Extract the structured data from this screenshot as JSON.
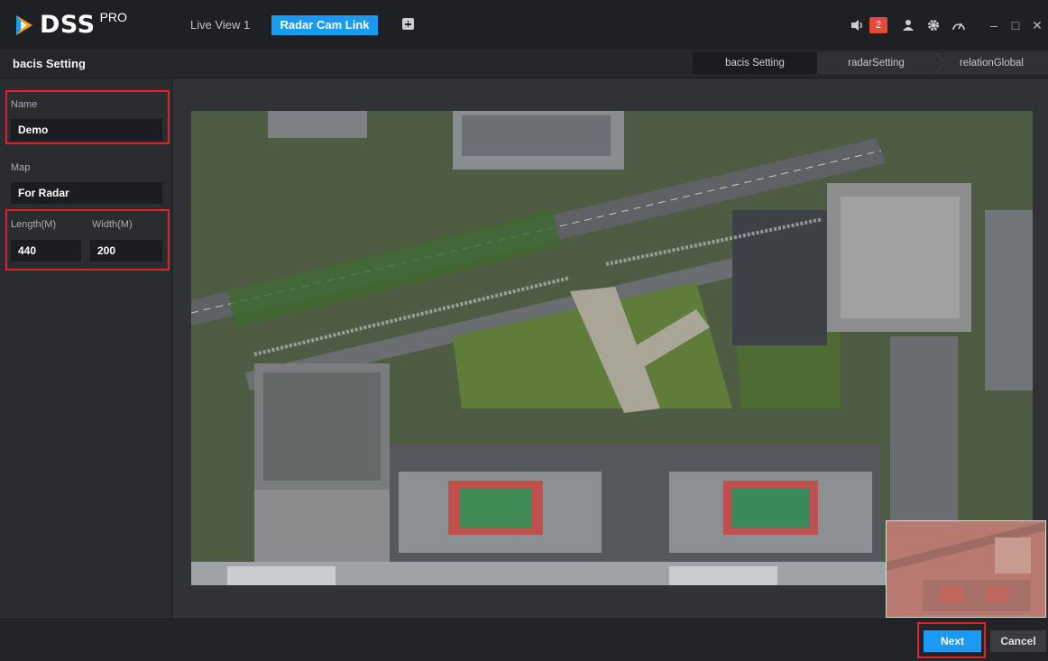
{
  "app": {
    "logo_text": "DSS",
    "logo_sup": "PRO"
  },
  "tabs": [
    {
      "label": "Live View 1",
      "active": false
    },
    {
      "label": "Radar Cam Link",
      "active": true
    }
  ],
  "topbar": {
    "alarm_count": "2",
    "icons": [
      "speaker-icon",
      "user-icon",
      "gear-icon",
      "gauge-icon"
    ]
  },
  "window": {
    "minimize": "–",
    "maximize": "□",
    "close": "✕"
  },
  "header": {
    "title": "bacis Setting"
  },
  "steps": [
    "bacis Setting",
    "radarSetting",
    "relationGlobal"
  ],
  "form": {
    "name_label": "Name",
    "name_value": "Demo",
    "map_label": "Map",
    "map_value": "For Radar",
    "length_label": "Length(M)",
    "length_value": "440",
    "width_label": "Width(M)",
    "width_value": "200"
  },
  "buttons": {
    "next": "Next",
    "cancel": "Cancel"
  },
  "colors": {
    "accent": "#1a9af2",
    "highlight": "#e2222a",
    "alarm": "#e34a3c"
  }
}
